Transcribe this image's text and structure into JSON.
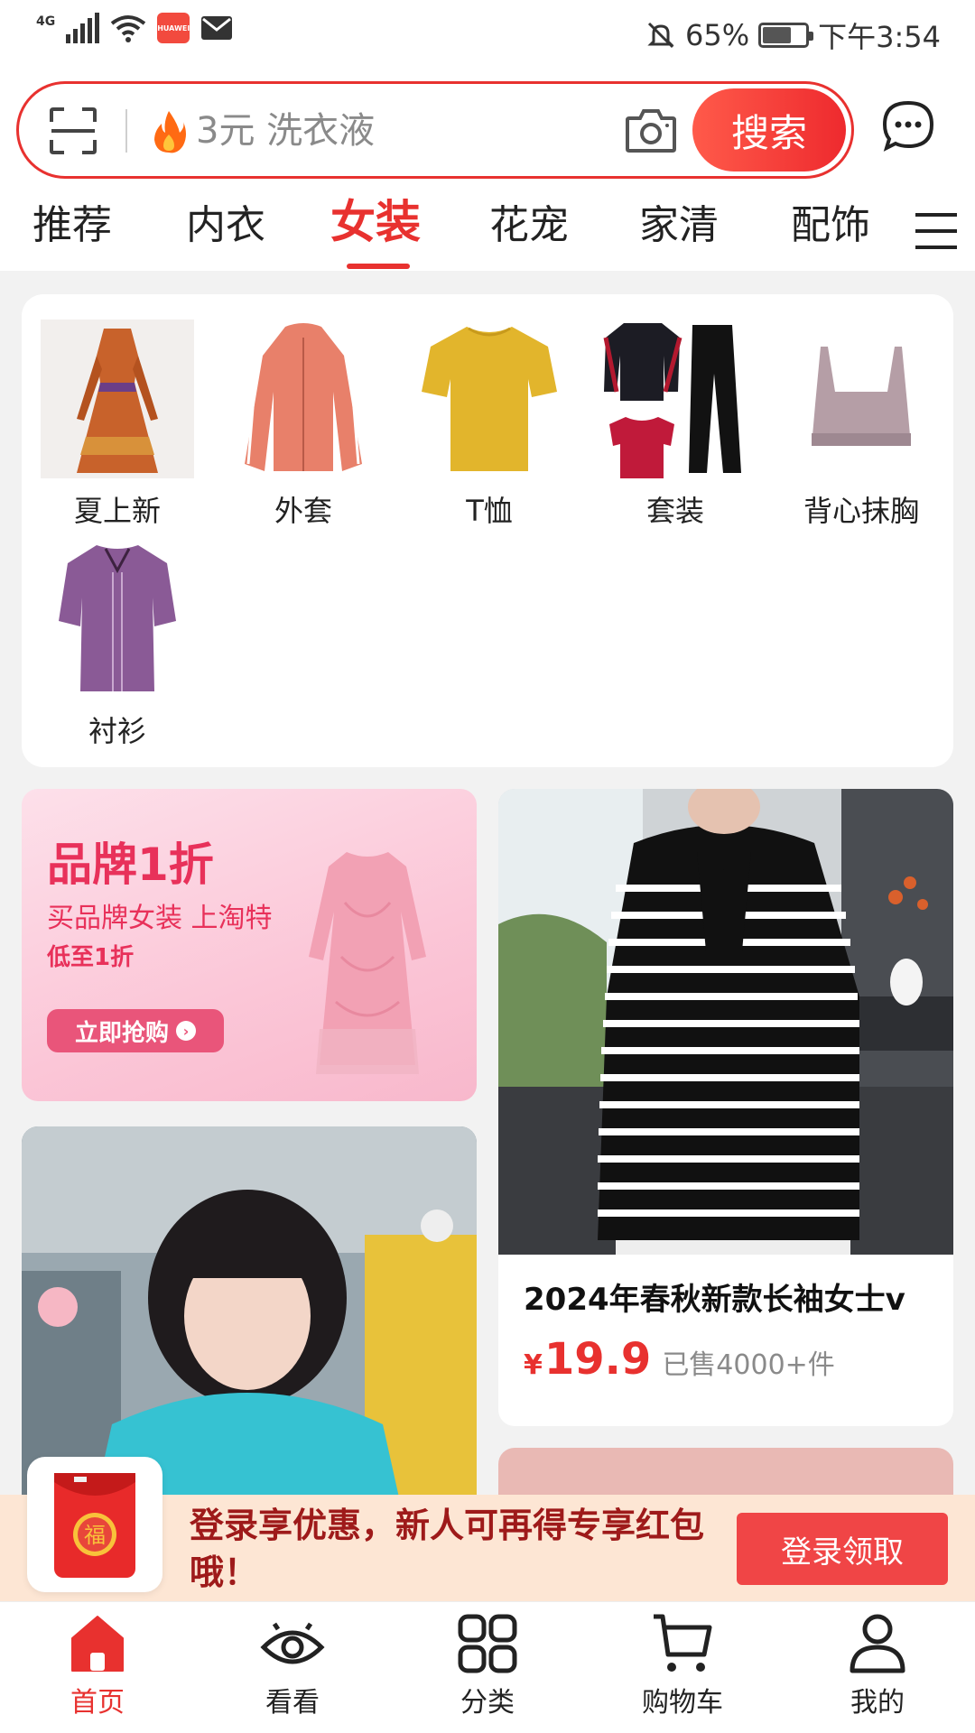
{
  "status_bar": {
    "network": "4G",
    "app_badge": "HUAWEI",
    "battery_percent": "65%",
    "time": "下午3:54",
    "battery_level": 0.65
  },
  "search": {
    "placeholder": "3元 洗衣液",
    "button_label": "搜索",
    "icons": [
      "scan-icon",
      "fire-icon",
      "camera-icon",
      "chat-icon"
    ]
  },
  "tabs": {
    "items": [
      "推荐",
      "内衣",
      "女装",
      "花宠",
      "家清",
      "配饰"
    ],
    "active": "女装"
  },
  "subcategories": [
    "夏上新",
    "外套",
    "T恤",
    "套装",
    "背心抹胸",
    "衬衫"
  ],
  "promo": {
    "title": "品牌1折",
    "line1": "买品牌女装  上淘特",
    "line2": "低至1折",
    "button": "立即抢购"
  },
  "product": {
    "title": "2024年春秋新款长袖女士v",
    "currency": "¥",
    "price": "19.9",
    "sold": "已售4000+件"
  },
  "login_banner": {
    "text": "登录享优惠，新人可再得专享红包哦！",
    "button": "登录领取",
    "packet_char": "福"
  },
  "bottom_nav": {
    "items": [
      "首页",
      "看看",
      "分类",
      "购物车",
      "我的"
    ],
    "active": "首页"
  },
  "colors": {
    "accent": "#e8312f",
    "promo_pink": "#e8315a",
    "banner_bg": "#fde6d4"
  }
}
